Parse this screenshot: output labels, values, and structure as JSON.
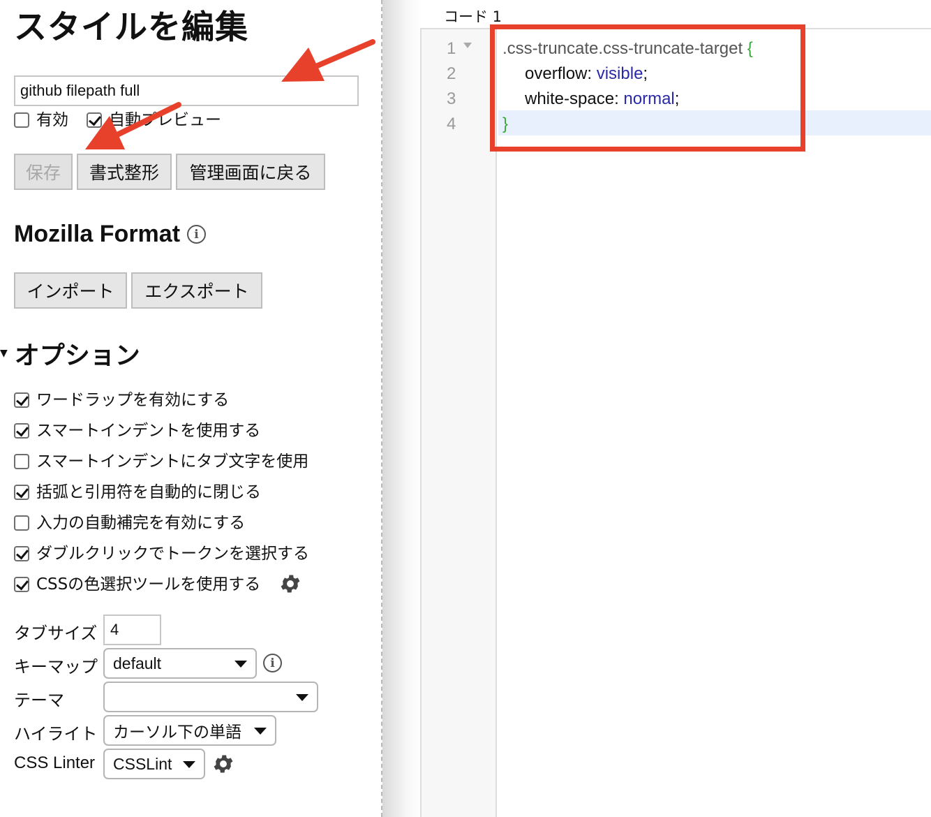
{
  "sidebar": {
    "title": "スタイルを編集",
    "style_name": "github filepath full",
    "checkboxes": [
      {
        "label": "有効",
        "checked": false
      },
      {
        "label": "自動プレビュー",
        "checked": true
      }
    ],
    "buttons": {
      "save": "保存",
      "beautify": "書式整形",
      "back": "管理画面に戻る"
    },
    "mozilla_format": {
      "title": "Mozilla Format",
      "import": "インポート",
      "export": "エクスポート"
    },
    "options": {
      "title": "オプション",
      "items": [
        {
          "label": "ワードラップを有効にする",
          "checked": true
        },
        {
          "label": "スマートインデントを使用する",
          "checked": true
        },
        {
          "label": "スマートインデントにタブ文字を使用",
          "checked": false
        },
        {
          "label": "括弧と引用符を自動的に閉じる",
          "checked": true
        },
        {
          "label": "入力の自動補完を有効にする",
          "checked": false
        },
        {
          "label": "ダブルクリックでトークンを選択する",
          "checked": true
        },
        {
          "label": "CSSの色選択ツールを使用する",
          "checked": true
        }
      ],
      "tab_size_label": "タブサイズ",
      "tab_size_value": "4",
      "keymap_label": "キーマップ",
      "keymap_value": "default",
      "theme_label": "テーマ",
      "theme_value": "",
      "highlight_label": "ハイライト",
      "highlight_value": "カーソル下の単語",
      "linter_label": "CSS Linter",
      "linter_value": "CSSLint"
    }
  },
  "editor": {
    "label": "コード 1",
    "line_numbers": [
      "1",
      "2",
      "3",
      "4"
    ],
    "code": {
      "selector": ".css-truncate.css-truncate-target",
      "open_brace": "{",
      "prop1": "overflow",
      "val1": "visible",
      "prop2": "white-space",
      "val2": "normal",
      "close_brace": "}",
      "colon": ":",
      "semicolon": ";"
    }
  },
  "colors": {
    "annotation": "#e8412b",
    "brace": "#3aa83a",
    "value": "#2a2aa8"
  }
}
